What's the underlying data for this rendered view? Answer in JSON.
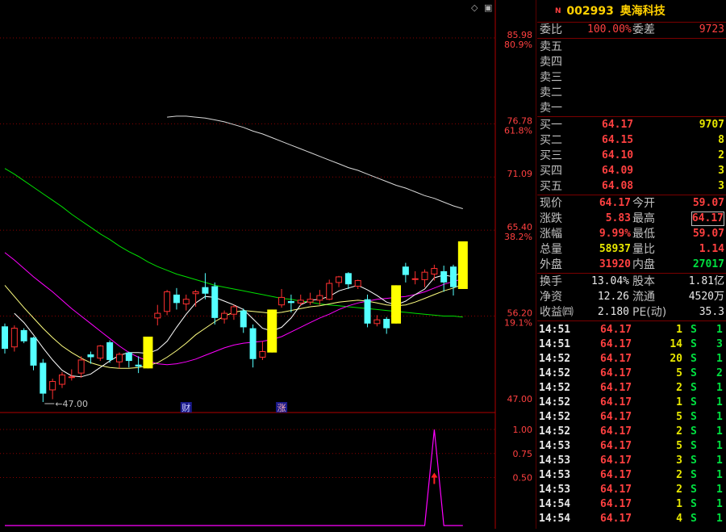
{
  "stock": {
    "marker": "N",
    "code": "002993",
    "name": "奥海科技"
  },
  "weibi": {
    "label1": "委比",
    "value1": "100.00%",
    "label2": "委差",
    "value2": "9723"
  },
  "asks": [
    {
      "label": "卖五",
      "price": "",
      "vol": ""
    },
    {
      "label": "卖四",
      "price": "",
      "vol": ""
    },
    {
      "label": "卖三",
      "price": "",
      "vol": ""
    },
    {
      "label": "卖二",
      "price": "",
      "vol": ""
    },
    {
      "label": "卖一",
      "price": "",
      "vol": ""
    }
  ],
  "bids": [
    {
      "label": "买一",
      "price": "64.17",
      "vol": "9707"
    },
    {
      "label": "买二",
      "price": "64.15",
      "vol": "8"
    },
    {
      "label": "买三",
      "price": "64.10",
      "vol": "2"
    },
    {
      "label": "买四",
      "price": "64.09",
      "vol": "3"
    },
    {
      "label": "买五",
      "price": "64.08",
      "vol": "3"
    }
  ],
  "quote": [
    {
      "l1": "现价",
      "v1": "64.17",
      "c1": "red",
      "l2": "今开",
      "v2": "59.07",
      "c2": "red"
    },
    {
      "l1": "涨跌",
      "v1": "5.83",
      "c1": "red",
      "l2": "最高",
      "v2": "64.17",
      "c2": "red"
    },
    {
      "l1": "涨幅",
      "v1": "9.99%",
      "c1": "red",
      "l2": "最低",
      "v2": "59.07",
      "c2": "red"
    },
    {
      "l1": "总量",
      "v1": "58937",
      "c1": "yellow",
      "l2": "量比",
      "v2": "1.14",
      "c2": "red"
    },
    {
      "l1": "外盘",
      "v1": "31920",
      "c1": "red",
      "l2": "内盘",
      "v2": "27017",
      "c2": "green"
    }
  ],
  "fundamentals": [
    {
      "l1": "换手",
      "v1": "13.04%",
      "l2": "股本",
      "v2": "1.81亿"
    },
    {
      "l1": "净资",
      "v1": "12.26",
      "l2": "流通",
      "v2": "4520万"
    },
    {
      "l1": "收益㈣",
      "v1": "2.180",
      "l2": "PE(动)",
      "v2": "35.3"
    }
  ],
  "ticks": [
    {
      "time": "14:51",
      "price": "64.17",
      "vol": "1",
      "vc": "yellow",
      "side": "S",
      "n": "1"
    },
    {
      "time": "14:51",
      "price": "64.17",
      "vol": "14",
      "vc": "yellow",
      "side": "S",
      "n": "3"
    },
    {
      "time": "14:52",
      "price": "64.17",
      "vol": "20",
      "vc": "yellow",
      "side": "S",
      "n": "1"
    },
    {
      "time": "14:52",
      "price": "64.17",
      "vol": "5",
      "vc": "yellow",
      "side": "S",
      "n": "2"
    },
    {
      "time": "14:52",
      "price": "64.17",
      "vol": "2",
      "vc": "yellow",
      "side": "S",
      "n": "1"
    },
    {
      "time": "14:52",
      "price": "64.17",
      "vol": "1",
      "vc": "yellow",
      "side": "S",
      "n": "1"
    },
    {
      "time": "14:52",
      "price": "64.17",
      "vol": "5",
      "vc": "yellow",
      "side": "S",
      "n": "1"
    },
    {
      "time": "14:52",
      "price": "64.17",
      "vol": "2",
      "vc": "yellow",
      "side": "S",
      "n": "1"
    },
    {
      "time": "14:53",
      "price": "64.17",
      "vol": "5",
      "vc": "yellow",
      "side": "S",
      "n": "1"
    },
    {
      "time": "14:53",
      "price": "64.17",
      "vol": "3",
      "vc": "yellow",
      "side": "S",
      "n": "1"
    },
    {
      "time": "14:53",
      "price": "64.17",
      "vol": "2",
      "vc": "yellow",
      "side": "S",
      "n": "1"
    },
    {
      "time": "14:53",
      "price": "64.17",
      "vol": "2",
      "vc": "yellow",
      "side": "S",
      "n": "1"
    },
    {
      "time": "14:54",
      "price": "64.17",
      "vol": "1",
      "vc": "yellow",
      "side": "S",
      "n": "1"
    },
    {
      "time": "14:54",
      "price": "64.17",
      "vol": "4",
      "vc": "yellow",
      "side": "S",
      "n": "1"
    }
  ],
  "chart_data": {
    "type": "candlestick",
    "price_axis": [
      {
        "value": "85.98",
        "pct": "80.9%"
      },
      {
        "value": "76.78",
        "pct": "61.8%"
      },
      {
        "value": "71.09",
        "pct": ""
      },
      {
        "value": "65.40",
        "pct": "38.2%"
      },
      {
        "value": "56.20",
        "pct": "19.1%"
      },
      {
        "value": "47.00",
        "pct": ""
      }
    ],
    "low_marker": "47.00",
    "event_labels": [
      {
        "text": "财",
        "candle": 19
      },
      {
        "text": "涨",
        "candle": 29
      }
    ],
    "indicator_axis": [
      "1.00",
      "0.75",
      "0.50"
    ],
    "candles": [
      {
        "o": 55.1,
        "h": 55.4,
        "l": 52.2,
        "c": 52.7
      },
      {
        "o": 52.9,
        "h": 55.2,
        "l": 52.4,
        "c": 54.9
      },
      {
        "o": 54.7,
        "h": 54.9,
        "l": 53.3,
        "c": 53.5
      },
      {
        "o": 53.9,
        "h": 54.0,
        "l": 50.4,
        "c": 50.9
      },
      {
        "o": 51.2,
        "h": 51.6,
        "l": 47.0,
        "c": 47.9
      },
      {
        "o": 48.3,
        "h": 49.5,
        "l": 47.3,
        "c": 49.2
      },
      {
        "o": 48.9,
        "h": 50.2,
        "l": 48.5,
        "c": 49.9
      },
      {
        "o": 49.7,
        "h": 50.5,
        "l": 49.3,
        "c": 49.7
      },
      {
        "o": 50.1,
        "h": 51.9,
        "l": 49.6,
        "c": 51.5
      },
      {
        "o": 52.1,
        "h": 52.4,
        "l": 51.1,
        "c": 51.8
      },
      {
        "o": 51.7,
        "h": 53.1,
        "l": 51.4,
        "c": 53.0
      },
      {
        "o": 53.4,
        "h": 53.6,
        "l": 51.2,
        "c": 51.5
      },
      {
        "o": 51.3,
        "h": 52.3,
        "l": 50.6,
        "c": 52.1
      },
      {
        "o": 52.3,
        "h": 52.4,
        "l": 50.7,
        "c": 51.4
      },
      {
        "o": 51.0,
        "h": 51.9,
        "l": 50.1,
        "c": 50.8
      },
      {
        "o": 50.6,
        "h": 54.0,
        "l": 50.6,
        "c": 54.0
      },
      {
        "o": 56.0,
        "h": 57.4,
        "l": 55.2,
        "c": 56.5
      },
      {
        "o": 56.7,
        "h": 59.0,
        "l": 56.3,
        "c": 58.8
      },
      {
        "o": 58.5,
        "h": 59.2,
        "l": 56.9,
        "c": 57.6
      },
      {
        "o": 57.5,
        "h": 58.5,
        "l": 56.8,
        "c": 58.0
      },
      {
        "o": 58.6,
        "h": 59.0,
        "l": 57.2,
        "c": 58.8
      },
      {
        "o": 59.3,
        "h": 60.8,
        "l": 58.0,
        "c": 58.6
      },
      {
        "o": 59.4,
        "h": 59.8,
        "l": 55.3,
        "c": 56.0
      },
      {
        "o": 55.9,
        "h": 56.8,
        "l": 55.4,
        "c": 56.5
      },
      {
        "o": 56.4,
        "h": 57.4,
        "l": 55.8,
        "c": 57.2
      },
      {
        "o": 56.8,
        "h": 57.0,
        "l": 54.4,
        "c": 55.0
      },
      {
        "o": 54.9,
        "h": 55.3,
        "l": 50.7,
        "c": 51.6
      },
      {
        "o": 51.8,
        "h": 53.5,
        "l": 51.5,
        "c": 52.4
      },
      {
        "o": 52.3,
        "h": 56.9,
        "l": 52.3,
        "c": 56.9
      },
      {
        "o": 57.4,
        "h": 59.1,
        "l": 57.1,
        "c": 58.2
      },
      {
        "o": 57.8,
        "h": 58.5,
        "l": 56.6,
        "c": 57.6
      },
      {
        "o": 57.6,
        "h": 58.5,
        "l": 57.3,
        "c": 57.9
      },
      {
        "o": 57.7,
        "h": 58.7,
        "l": 57.4,
        "c": 58.0
      },
      {
        "o": 57.9,
        "h": 59.0,
        "l": 57.4,
        "c": 58.4
      },
      {
        "o": 58.0,
        "h": 60.1,
        "l": 57.9,
        "c": 59.7
      },
      {
        "o": 59.8,
        "h": 60.5,
        "l": 59.3,
        "c": 60.4
      },
      {
        "o": 60.8,
        "h": 60.9,
        "l": 59.1,
        "c": 59.6
      },
      {
        "o": 59.4,
        "h": 60.1,
        "l": 59.1,
        "c": 60.0
      },
      {
        "o": 58.0,
        "h": 58.5,
        "l": 55.0,
        "c": 55.4
      },
      {
        "o": 55.4,
        "h": 56.3,
        "l": 55.1,
        "c": 55.8
      },
      {
        "o": 55.9,
        "h": 56.1,
        "l": 54.3,
        "c": 54.9
      },
      {
        "o": 55.4,
        "h": 59.5,
        "l": 55.4,
        "c": 59.5
      },
      {
        "o": 61.5,
        "h": 61.9,
        "l": 59.8,
        "c": 60.6
      },
      {
        "o": 60.2,
        "h": 61.0,
        "l": 59.6,
        "c": 60.2
      },
      {
        "o": 60.1,
        "h": 61.2,
        "l": 59.3,
        "c": 60.9
      },
      {
        "o": 60.7,
        "h": 61.7,
        "l": 60.0,
        "c": 61.3
      },
      {
        "o": 61.0,
        "h": 61.6,
        "l": 58.8,
        "c": 59.8
      },
      {
        "o": 61.5,
        "h": 61.7,
        "l": 58.4,
        "c": 59.3
      },
      {
        "o": 59.1,
        "h": 64.2,
        "l": 59.1,
        "c": 64.2
      }
    ],
    "ma_series": [
      {
        "color": "#ffffff",
        "values": [
          null,
          null,
          null,
          null,
          null,
          null,
          null,
          null,
          null,
          null,
          null,
          null,
          null,
          null,
          null,
          null,
          null,
          77.5,
          77.6,
          77.6,
          77.5,
          77.4,
          77.2,
          77.0,
          76.7,
          76.4,
          76.0,
          75.7,
          75.3,
          74.9,
          74.5,
          74.1,
          73.7,
          73.3,
          72.9,
          72.5,
          72.1,
          71.8,
          71.4,
          71.0,
          70.6,
          70.2,
          69.9,
          69.5,
          69.1,
          68.8,
          68.4,
          68.0,
          67.7
        ]
      },
      {
        "color": "#00e000",
        "values": [
          72.0,
          71.4,
          70.7,
          70.0,
          69.3,
          68.6,
          67.9,
          67.1,
          66.4,
          65.7,
          65.0,
          64.4,
          63.7,
          63.1,
          62.6,
          62.0,
          61.5,
          61.1,
          60.7,
          60.4,
          60.1,
          59.8,
          59.5,
          59.3,
          59.1,
          58.9,
          58.7,
          58.5,
          58.3,
          58.1,
          58.0,
          57.8,
          57.7,
          57.5,
          57.4,
          57.3,
          57.2,
          57.1,
          57.0,
          56.9,
          56.8,
          56.7,
          56.6,
          56.5,
          56.4,
          56.3,
          56.2,
          56.2,
          56.1
        ]
      },
      {
        "color": "#ff00ff",
        "values": [
          63.0,
          62.2,
          61.3,
          60.4,
          59.6,
          58.8,
          57.9,
          57.0,
          56.2,
          55.4,
          54.6,
          53.8,
          53.0,
          52.3,
          51.8,
          51.4,
          51.1,
          51.0,
          51.1,
          51.3,
          51.6,
          52.0,
          52.4,
          52.8,
          53.1,
          53.3,
          53.4,
          53.5,
          53.7,
          54.0,
          54.5,
          55.0,
          55.5,
          56.0,
          56.4,
          56.9,
          57.3,
          57.6,
          57.8,
          58.0,
          58.1,
          58.2,
          58.3,
          58.5,
          58.8,
          59.2,
          59.6,
          59.9,
          60.2
        ]
      },
      {
        "color": "#ffff80",
        "values": [
          59.5,
          58.3,
          57.1,
          56.0,
          54.9,
          53.9,
          53.0,
          52.3,
          51.7,
          51.2,
          50.9,
          50.7,
          50.6,
          50.6,
          50.7,
          50.9,
          51.2,
          51.8,
          52.5,
          53.3,
          54.2,
          54.9,
          55.6,
          56.2,
          56.6,
          56.8,
          56.7,
          56.6,
          56.5,
          56.6,
          56.8,
          57.0,
          57.2,
          57.3,
          57.5,
          57.7,
          57.8,
          57.9,
          57.8,
          57.6,
          57.4,
          57.3,
          57.4,
          57.7,
          58.1,
          58.5,
          58.9,
          59.2,
          59.6
        ]
      },
      {
        "color": "#ffffff",
        "values": [
          null,
          56.5,
          55.5,
          54.2,
          52.8,
          51.5,
          50.4,
          49.8,
          49.7,
          50.0,
          50.7,
          51.4,
          52.0,
          52.3,
          52.3,
          52.2,
          52.6,
          53.5,
          55.0,
          56.4,
          57.6,
          58.3,
          58.2,
          57.8,
          57.4,
          56.9,
          55.9,
          54.9,
          54.6,
          55.0,
          56.0,
          57.4,
          57.9,
          58.0,
          58.3,
          58.9,
          59.2,
          59.5,
          59.0,
          58.4,
          57.7,
          57.4,
          57.8,
          58.5,
          59.1,
          60.3,
          60.6,
          60.4,
          61.0
        ]
      }
    ],
    "indicator": {
      "values": [
        0,
        0,
        0,
        0,
        0,
        0,
        0,
        0,
        0,
        0,
        0,
        0,
        0,
        0,
        0,
        0,
        0,
        0,
        0,
        0,
        0,
        0,
        0,
        0,
        0,
        0,
        0,
        0,
        0,
        0,
        0,
        0,
        0,
        0,
        0,
        0,
        0,
        0,
        0,
        0,
        0,
        0,
        0,
        0,
        0,
        1.0,
        0,
        0,
        0
      ],
      "marker_value": 0.5
    }
  }
}
